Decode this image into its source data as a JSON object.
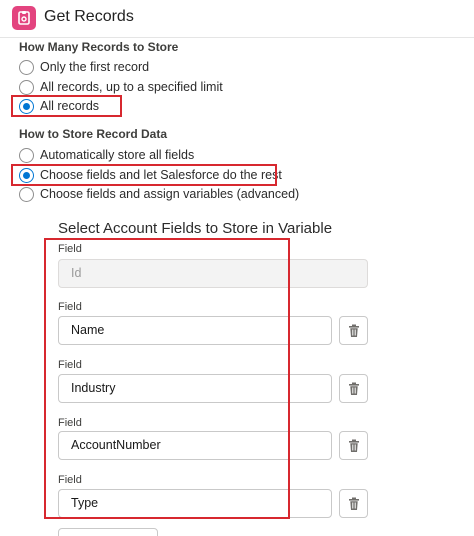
{
  "header": {
    "title": "Get Records",
    "icon": "records-icon",
    "icon_color": "#e3447f"
  },
  "records_section": {
    "label": "How Many Records to Store",
    "options": [
      {
        "label": "Only the first record",
        "selected": false
      },
      {
        "label": "All records, up to a specified limit",
        "selected": false
      },
      {
        "label": "All records",
        "selected": true
      }
    ]
  },
  "storage_section": {
    "label": "How to Store Record Data",
    "options": [
      {
        "label": "Automatically store all fields",
        "selected": false
      },
      {
        "label": "Choose fields and let Salesforce do the rest",
        "selected": true
      },
      {
        "label": "Choose fields and assign variables (advanced)",
        "selected": false
      }
    ]
  },
  "fields_section": {
    "title": "Select Account Fields to Store in Variable",
    "field_label": "Field",
    "fields": [
      {
        "value": "Id",
        "disabled": true
      },
      {
        "value": "Name",
        "disabled": false
      },
      {
        "value": "Industry",
        "disabled": false
      },
      {
        "value": "AccountNumber",
        "disabled": false
      },
      {
        "value": "Type",
        "disabled": false
      }
    ]
  },
  "colors": {
    "accent": "#0176d3",
    "highlight": "#d7282f"
  }
}
